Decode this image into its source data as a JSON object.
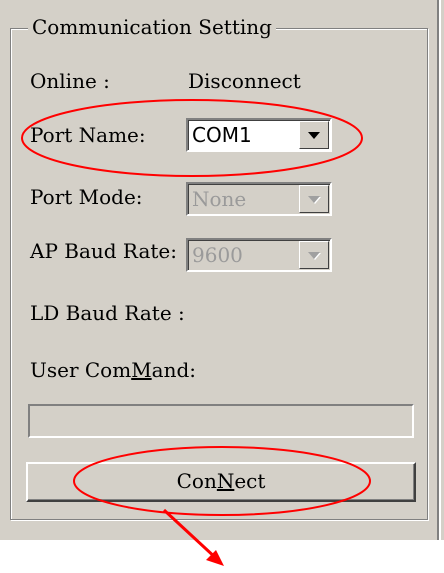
{
  "group": {
    "title": "Communication Setting"
  },
  "online": {
    "label": "Online :",
    "value": "Disconnect"
  },
  "port_name": {
    "label": "Port Name:",
    "value": "COM1"
  },
  "port_mode": {
    "label": "Port Mode:",
    "value": "None"
  },
  "ap_baud": {
    "label": "AP Baud Rate:",
    "value": "9600"
  },
  "ld_baud": {
    "label": "LD Baud Rate :"
  },
  "user_command": {
    "label_pre": "User Com",
    "label_accel": "M",
    "label_post": "and:",
    "value": ""
  },
  "connect_button": {
    "label_pre": "Con",
    "label_accel": "N",
    "label_post": "ect"
  },
  "annotation": {
    "color": "#ff0000"
  }
}
